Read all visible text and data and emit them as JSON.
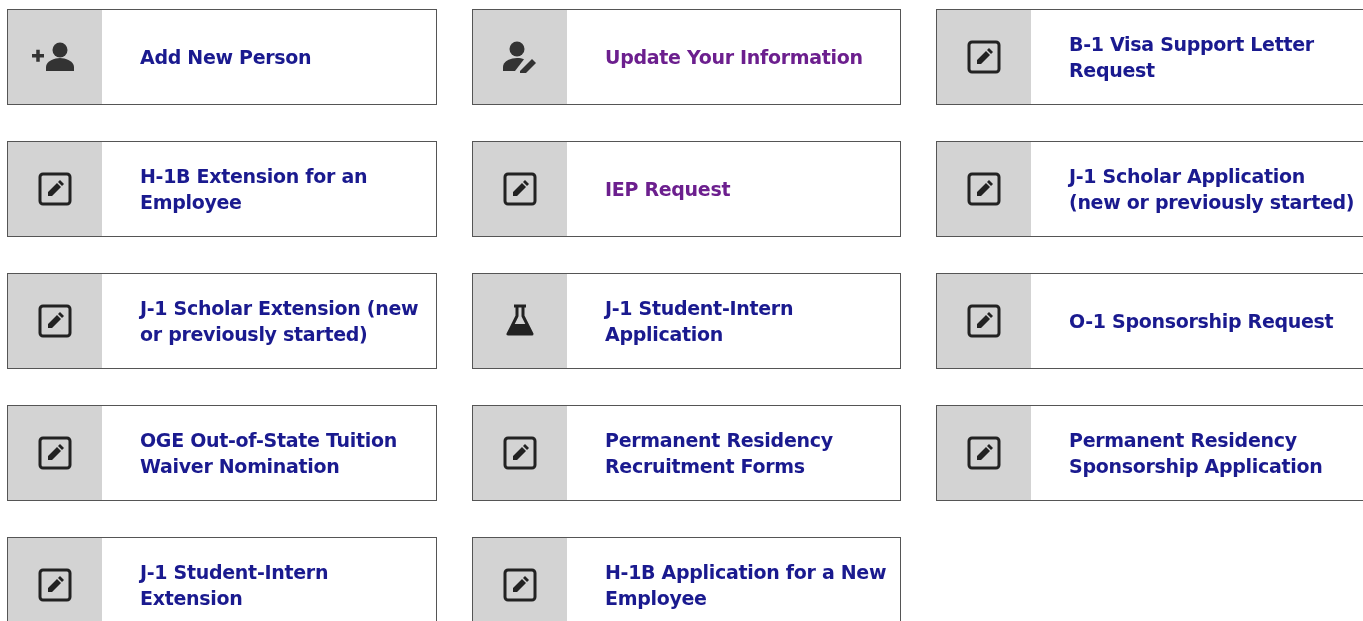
{
  "tiles": [
    {
      "label": "Add New Person",
      "kind": "add",
      "visited": false
    },
    {
      "label": "Update Your Information",
      "kind": "profile",
      "visited": true
    },
    {
      "label": "B-1 Visa Support Letter Request",
      "kind": "form",
      "visited": false
    },
    {
      "label": "H-1B Extension for an Employee",
      "kind": "form",
      "visited": false
    },
    {
      "label": "IEP Request",
      "kind": "form",
      "visited": true
    },
    {
      "label": "J-1 Scholar Application (new or previously started)",
      "kind": "form",
      "visited": false
    },
    {
      "label": "J-1 Scholar Extension (new or previously started)",
      "kind": "form",
      "visited": false
    },
    {
      "label": "J-1 Student-Intern Application",
      "kind": "lab",
      "visited": false
    },
    {
      "label": "O-1 Sponsorship Request",
      "kind": "form",
      "visited": false
    },
    {
      "label": "OGE Out-of-State Tuition Waiver Nomination",
      "kind": "form",
      "visited": false
    },
    {
      "label": "Permanent Residency Recruitment Forms",
      "kind": "form",
      "visited": false
    },
    {
      "label": "Permanent Residency Sponsorship Application",
      "kind": "form",
      "visited": false
    },
    {
      "label": "J-1 Student-Intern Extension",
      "kind": "form",
      "visited": false
    },
    {
      "label": "H-1B Application for a New Employee",
      "kind": "form",
      "visited": false
    }
  ]
}
